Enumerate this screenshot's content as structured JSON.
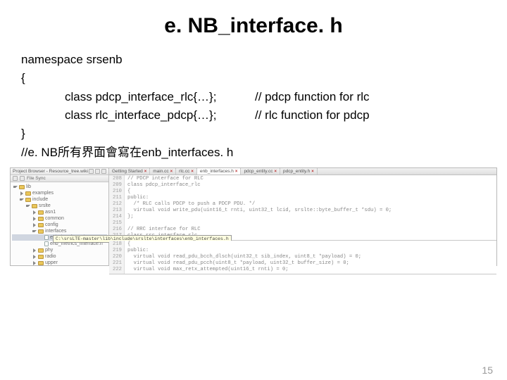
{
  "title": "e. NB_interface. h",
  "code": {
    "ns_open": "namespace srsenb",
    "brace_open": "{",
    "decl1": "class pdcp_interface_rlc{…};",
    "comment1": "// pdcp function for rlc",
    "decl2": "class rlc_interface_pdcp{…};",
    "comment2": "// rlc function for pdcp",
    "brace_close": "}",
    "note": "//e. NB所有界面會寫在enb_interfaces. h"
  },
  "ide": {
    "project_header": "Project Browser - Resource_tree.wiki",
    "filesync": "File Sync",
    "tree": [
      {
        "d": 0,
        "t": "open",
        "k": "folder",
        "l": "lib"
      },
      {
        "d": 1,
        "t": "closed",
        "k": "folder",
        "l": "examples"
      },
      {
        "d": 1,
        "t": "open",
        "k": "folder",
        "l": "include"
      },
      {
        "d": 2,
        "t": "open",
        "k": "folder",
        "l": "srslte"
      },
      {
        "d": 3,
        "t": "closed",
        "k": "folder",
        "l": "asn1"
      },
      {
        "d": 3,
        "t": "closed",
        "k": "folder",
        "l": "common"
      },
      {
        "d": 3,
        "t": "closed",
        "k": "folder",
        "l": "config"
      },
      {
        "d": 3,
        "t": "open",
        "k": "folder",
        "l": "interfaces"
      },
      {
        "d": 4,
        "t": "",
        "k": "file",
        "l": "enb_interfaces.h",
        "sel": true
      },
      {
        "d": 4,
        "t": "",
        "k": "file",
        "l": "enb_metrics_interface.h"
      },
      {
        "d": 3,
        "t": "closed",
        "k": "folder",
        "l": "phy"
      },
      {
        "d": 3,
        "t": "closed",
        "k": "folder",
        "l": "radio"
      },
      {
        "d": 3,
        "t": "closed",
        "k": "folder",
        "l": "upper"
      }
    ],
    "tooltip": "C:\\srsLTE-master\\lib\\include\\srslte\\interfaces\\enb_interfaces.h",
    "tabs": [
      {
        "l": "Getting Started",
        "x": true,
        "a": false
      },
      {
        "l": "main.cc",
        "x": true,
        "a": false
      },
      {
        "l": "rlc.cc",
        "x": true,
        "a": false
      },
      {
        "l": "enb_interfaces.h",
        "x": true,
        "a": true
      },
      {
        "l": "pdcp_entity.cc",
        "x": true,
        "a": false
      },
      {
        "l": "pdcp_entity.h",
        "x": true,
        "a": false
      }
    ],
    "topEditor": {
      "start": 208,
      "lines": [
        "// PDCP interface for RLC",
        "class pdcp_interface_rlc",
        "{",
        "public:",
        "  /* RLC calls PDCP to push a PDCP PDU. */",
        "  virtual void write_pdu(uint16_t rnti, uint32_t lcid, srslte::byte_buffer_t *sdu) = 0;",
        "};",
        "",
        "// RRC interface for RLC",
        "class rrc_interface_rlc"
      ]
    },
    "botEditor": {
      "start": 218,
      "lines": [
        "{",
        "public:",
        "  virtual void read_pdu_bcch_dlsch(uint32_t sib_index, uint8_t *payload) = 0;",
        "  virtual void read_pdu_pcch(uint8_t *payload, uint32_t buffer_size) = 0;",
        "  virtual void max_retx_attempted(uint16_t rnti) = 0;"
      ]
    }
  },
  "page_number": "15"
}
